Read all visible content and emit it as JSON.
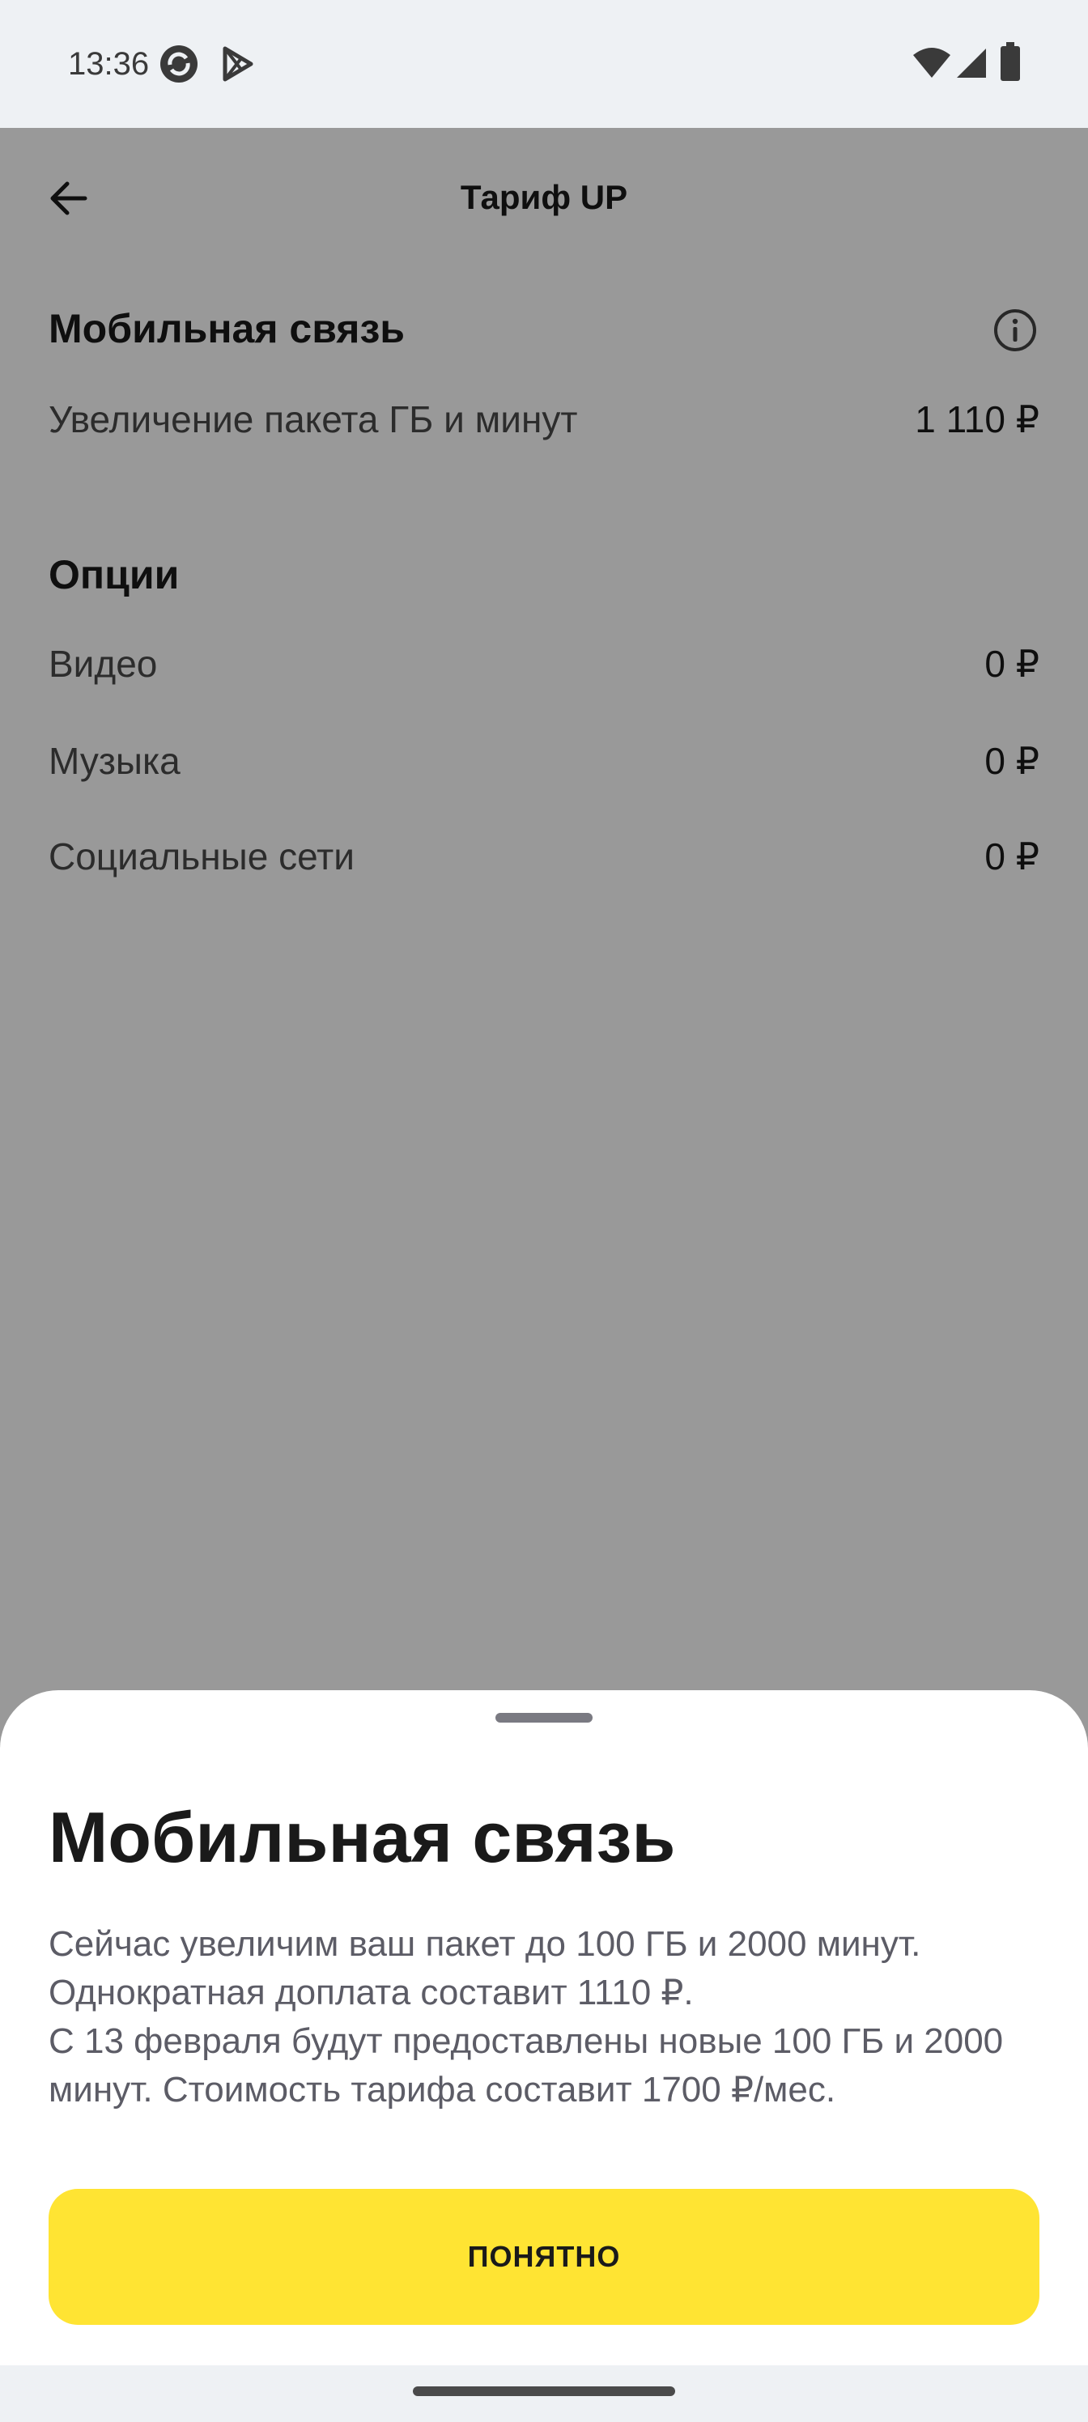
{
  "status_bar": {
    "time": "13:36",
    "icons": [
      "sync-app-icon",
      "play-store-icon",
      "wifi-icon",
      "signal-icon",
      "battery-icon"
    ]
  },
  "header": {
    "title": "Тариф UP",
    "back_icon": "arrow-left-icon"
  },
  "mobile_section": {
    "title": "Мобильная связь",
    "info_icon": "info-icon",
    "rows": [
      {
        "label": "Увеличение пакета ГБ и минут",
        "value": "1 110 ₽"
      }
    ]
  },
  "options_section": {
    "title": "Опции",
    "rows": [
      {
        "label": "Видео",
        "value": "0 ₽"
      },
      {
        "label": "Музыка",
        "value": "0 ₽"
      },
      {
        "label": "Социальные сети",
        "value": "0 ₽"
      }
    ]
  },
  "sheet": {
    "title": "Мобильная связь",
    "text": "Сейчас увеличим ваш пакет до 100 ГБ и 2000 минут.\nОднократная доплата составит 1110 ₽.\nС 13 февраля будут предоставлены новые 100 ГБ и 2000 минут. Стоимость тарифа составит 1700 ₽/мес.",
    "button_label": "ПОНЯТНО"
  },
  "colors": {
    "accent": "#ffe433",
    "scrim": "#9a9a9a",
    "status_bar_bg": "#eef1f4"
  }
}
